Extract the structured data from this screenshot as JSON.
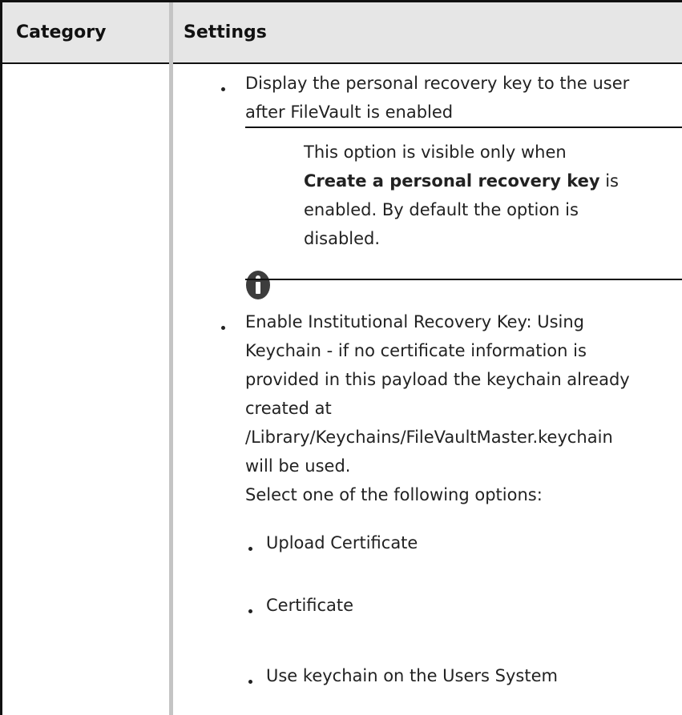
{
  "table": {
    "header": {
      "category": "Category",
      "settings": "Settings"
    }
  },
  "settings": {
    "item1": {
      "line1": "Display the personal recovery key to the user",
      "line2": "after FileVault is enabled"
    },
    "note": {
      "line1": "This option is visible only when",
      "line2_bold": "Create a personal recovery key",
      "line2_rest": " is",
      "line3": "enabled. By default the option is",
      "line4": "disabled.",
      "icon": "info-icon"
    },
    "item2": {
      "line1": "Enable Institutional Recovery Key: Using",
      "line2": "Keychain - if no certificate information is",
      "line3": "provided in this payload the keychain already",
      "line4": "created at",
      "line5": "/Library/Keychains/FileVaultMaster.keychain",
      "line6": "will be used.",
      "line7": " Select one of the following options:"
    },
    "options": [
      "Upload Certificate",
      "Certificate",
      "Use keychain on the Users System"
    ]
  }
}
